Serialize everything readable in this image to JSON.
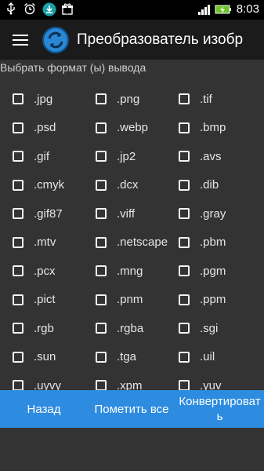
{
  "status_bar": {
    "time": "8:03",
    "icons": [
      "usb-icon",
      "alarm-icon",
      "download-icon",
      "gift-icon",
      "signal-icon",
      "battery-icon"
    ]
  },
  "app_bar": {
    "title": "Преобразователь изобр"
  },
  "section": {
    "title": "Выбрать формат (ы) вывода"
  },
  "formats": [
    [
      ".jpg",
      ".png",
      ".tif"
    ],
    [
      ".psd",
      ".webp",
      ".bmp"
    ],
    [
      ".gif",
      ".jp2",
      ".avs"
    ],
    [
      ".cmyk",
      ".dcx",
      ".dib"
    ],
    [
      ".gif87",
      ".viff",
      ".gray"
    ],
    [
      ".mtv",
      ".netscape",
      ".pbm"
    ],
    [
      ".pcx",
      ".mng",
      ".pgm"
    ],
    [
      ".pict",
      ".pnm",
      ".ppm"
    ],
    [
      ".rgb",
      ".rgba",
      ".sgi"
    ],
    [
      ".sun",
      ".tga",
      ".uil"
    ],
    [
      ".uyvy",
      ".xpm",
      ".yuv"
    ]
  ],
  "bottom_bar": {
    "back_label": "Назад",
    "select_all_label": "Пометить все",
    "convert_label": "Конвертировать"
  },
  "colors": {
    "accent": "#2d8be0",
    "background": "#333333"
  }
}
